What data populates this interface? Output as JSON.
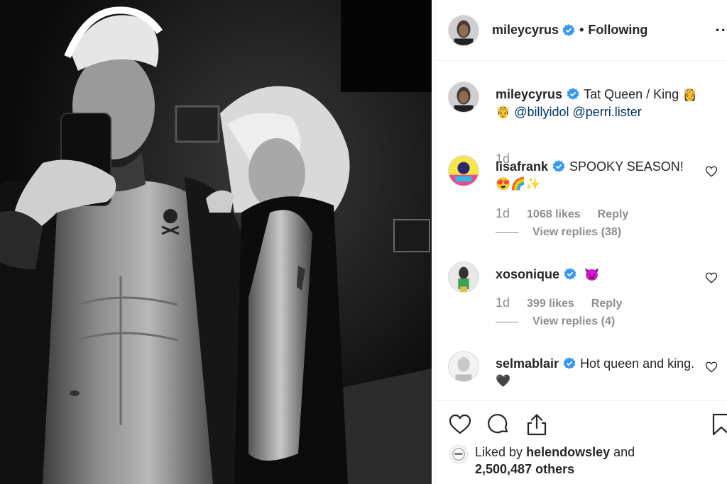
{
  "post": {
    "author": "mileycyrus",
    "follow_status": "Following",
    "separator": "•",
    "more": "··"
  },
  "caption": {
    "username": "mileycyrus",
    "text_before": "Tat Queen / King",
    "emoji_1": "👸",
    "emoji_2": "🤴",
    "mention_1": "@billyidol",
    "mention_2": "@perri.lister",
    "time": "1d"
  },
  "comments": [
    {
      "username": "lisafrank",
      "text": "SPOOKY SEASON!",
      "emoji": "😍🌈✨",
      "time": "1d",
      "likes": "1068 likes",
      "reply": "Reply",
      "view_replies": "View replies (38)"
    },
    {
      "username": "xosonique",
      "text": "",
      "emoji": "😈",
      "time": "1d",
      "likes": "399 likes",
      "reply": "Reply",
      "view_replies": "View replies (4)"
    },
    {
      "username": "selmablair",
      "text": "Hot queen and king.",
      "emoji": "🖤",
      "time": "",
      "likes": "",
      "reply": "",
      "view_replies": ""
    }
  ],
  "likes": {
    "prefix": "Liked by",
    "user": "helendowsley",
    "and": "and",
    "count": "2,500,487 others"
  },
  "colors": {
    "verified": "#3897f0",
    "mention": "#00376b",
    "secondary_text": "#8e8e8e"
  }
}
